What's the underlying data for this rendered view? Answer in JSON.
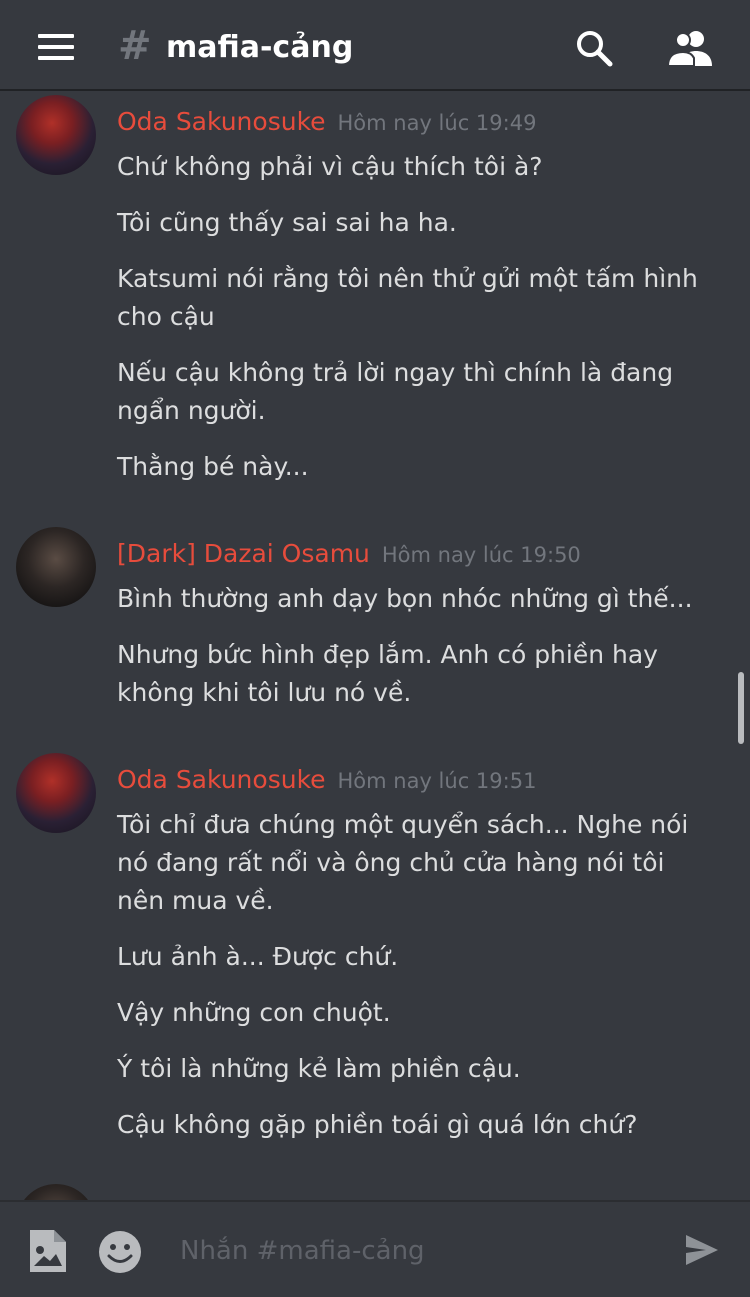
{
  "header": {
    "hash": "#",
    "channel_name": "mafia-cảng"
  },
  "messages": [
    {
      "author": "Oda Sakunosuke",
      "timestamp": "Hôm nay lúc 19:49",
      "lines": [
        "Chứ không phải vì cậu thích tôi à?",
        "Tôi cũng thấy sai sai ha ha.",
        "Katsumi nói rằng tôi nên thử gửi một tấm hình cho cậu",
        "Nếu cậu không trả lời ngay thì chính là đang ngẩn người.",
        "Thằng bé này..."
      ]
    },
    {
      "author": "[Dark] Dazai Osamu",
      "timestamp": "Hôm nay lúc 19:50",
      "lines": [
        "Bình thường anh dạy bọn nhóc những gì thế...",
        "Nhưng bức hình đẹp lắm. Anh có phiền hay không khi tôi lưu nó về."
      ]
    },
    {
      "author": "Oda Sakunosuke",
      "timestamp": "Hôm nay lúc 19:51",
      "lines": [
        "Tôi chỉ đưa chúng một quyển sách... Nghe nói nó đang rất nổi và ông chủ cửa hàng nói tôi nên mua về.",
        "Lưu ảnh à... Được chứ.",
        "Vậy những con chuột.",
        "Ý tôi là những kẻ làm phiền cậu.",
        "Cậu không gặp phiền toái gì quá lớn chứ?"
      ]
    }
  ],
  "composer": {
    "placeholder": "Nhắn #mafia-cảng",
    "value": ""
  },
  "icons": {
    "menu": "hamburger-menu-icon",
    "search": "search-icon",
    "members": "members-icon",
    "image": "image-upload-icon",
    "emoji": "emoji-icon",
    "send": "send-icon"
  },
  "colors": {
    "background": "#36393f",
    "author_name": "#e74c3c",
    "timestamp": "#72767d",
    "message_text": "#dcddde"
  }
}
